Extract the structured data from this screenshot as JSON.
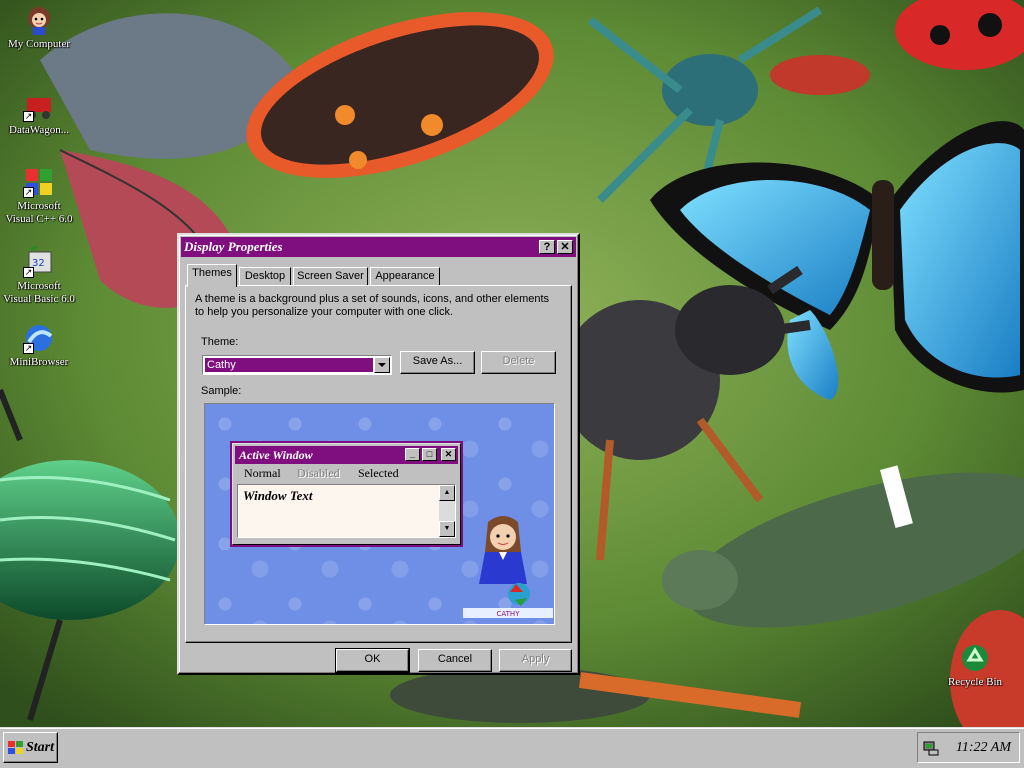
{
  "desktop": {
    "icons": [
      {
        "label": "My Computer",
        "icon": "cartoon-girl-icon"
      },
      {
        "label": "DataWagon...",
        "icon": "red-wagon-icon"
      },
      {
        "label": "Microsoft\nVisual C++ 6.0",
        "icon": "visual-cpp-icon"
      },
      {
        "label": "Microsoft\nVisual Basic 6.0",
        "icon": "visual-basic-icon"
      },
      {
        "label": "MiniBrowser",
        "icon": "globe-swirl-icon"
      },
      {
        "label": "Recycle Bin",
        "icon": "recycle-icon"
      }
    ]
  },
  "dialog": {
    "title": "Display Properties",
    "help_label": "?",
    "close_label": "✕",
    "tabs": [
      "Themes",
      "Desktop",
      "Screen Saver",
      "Appearance"
    ],
    "active_tab": "Themes",
    "description": "A theme is a background plus a set of sounds, icons, and other elements to help you personalize your computer with one click.",
    "theme_label": "Theme:",
    "theme_value": "Cathy",
    "save_as_label": "Save As...",
    "delete_label": "Delete",
    "sample_label": "Sample:",
    "preview": {
      "title": "Active Window",
      "min_label": "_",
      "max_label": "□",
      "close_label": "✕",
      "menu_normal": "Normal",
      "menu_disabled": "Disabled",
      "menu_selected": "Selected",
      "window_text": "Window Text",
      "mascot_caption": "CATHY"
    },
    "ok_label": "OK",
    "cancel_label": "Cancel",
    "apply_label": "Apply"
  },
  "taskbar": {
    "start_label": "Start",
    "clock": "11:22 AM"
  },
  "colors": {
    "accent": "#7f0f7f",
    "face": "#c0c0c0",
    "sample_bg": "#6f8fe6"
  }
}
